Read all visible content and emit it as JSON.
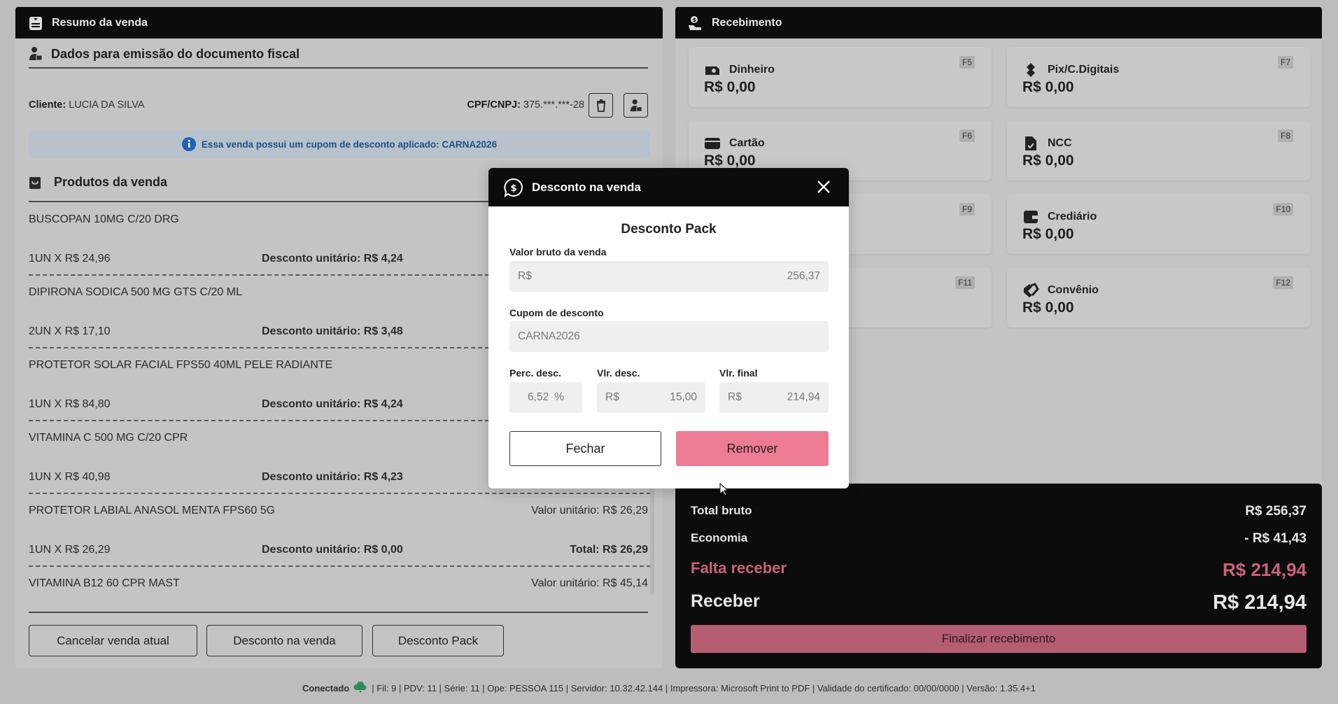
{
  "left_panel": {
    "title": "Resumo da venda",
    "fiscal_title": "Dados para emissão do documento fiscal",
    "client_label": "Cliente:",
    "client_name": "LUCIA DA SILVA",
    "cpf_label": "CPF/CNPJ:",
    "cpf_value": "375.***.***-28",
    "info_banner": "Essa venda possui um cupom de desconto aplicado: CARNA2026",
    "products_title": "Produtos da venda",
    "products": [
      {
        "name": "BUSCOPAN 10MG C/20 DRG",
        "qty": "1UN X R$ 24,96",
        "discount": "Desconto unitário: R$ 4,24"
      },
      {
        "name": "DIPIRONA SODICA 500 MG GTS C/20 ML",
        "qty": "2UN X R$ 17,10",
        "discount": "Desconto unitário: R$ 3,48"
      },
      {
        "name": "PROTETOR SOLAR FACIAL FPS50 40ML PELE RADIANTE",
        "qty": "1UN X R$ 84,80",
        "discount": "Desconto unitário: R$ 4,24"
      },
      {
        "name": "VITAMINA C 500 MG C/20 CPR",
        "qty": "1UN X R$ 40,98",
        "discount": "Desconto unitário: R$ 4,23"
      },
      {
        "name": "PROTETOR LABIAL ANASOL MENTA FPS60 5G",
        "unit": "Valor unitário: R$ 26,29",
        "qty": "1UN X R$ 26,29",
        "discount": "Desconto unitário: R$ 0,00",
        "total": "Total: R$ 26,29"
      },
      {
        "name": "VITAMINA B12 60 CPR MAST",
        "unit": "Valor unitário: R$ 45,14"
      }
    ],
    "buttons": {
      "cancel": "Cancelar venda atual",
      "sale_discount": "Desconto na venda",
      "pack_discount": "Desconto Pack"
    }
  },
  "right_panel": {
    "title": "Recebimento",
    "methods": [
      {
        "label": "Dinheiro",
        "amount": "R$  0,00",
        "key": "F5",
        "icon": "cash-icon"
      },
      {
        "label": "Pix/C.Digitais",
        "amount": "R$  0,00",
        "key": "F7",
        "icon": "pix-icon"
      },
      {
        "label": "Cartão",
        "amount": "R$  0,00",
        "key": "F6",
        "icon": "card-icon"
      },
      {
        "label": "NCC",
        "amount": "R$  0,00",
        "key": "F8",
        "icon": "document-check-icon"
      },
      {
        "label": "",
        "amount": "",
        "key": "F9",
        "icon": ""
      },
      {
        "label": "Crediário",
        "amount": "R$  0,00",
        "key": "F10",
        "icon": "wallet-icon"
      },
      {
        "label": "",
        "amount": "",
        "key": "F11",
        "icon": ""
      },
      {
        "label": "Convênio",
        "amount": "R$  0,00",
        "key": "F12",
        "icon": "handshake-icon"
      }
    ],
    "summary": {
      "total_bruto_label": "Total bruto",
      "total_bruto": "R$ 256,37",
      "economia_label": "Economia",
      "economia": "- R$ 41,43",
      "falta_label": "Falta receber",
      "falta": "R$ 214,94",
      "receber_label": "Receber",
      "receber": "R$ 214,94",
      "finalize": "Finalizar recebimento"
    }
  },
  "modal": {
    "title": "Desconto na venda",
    "subtitle": "Desconto Pack",
    "gross_label": "Valor bruto da venda",
    "gross_prefix": "R$",
    "gross_value": "256,37",
    "coupon_label": "Cupom de desconto",
    "coupon_value": "CARNA2026",
    "perc_label": "Perc. desc.",
    "perc_value": "6,52",
    "perc_suffix": "%",
    "vlr_label": "Vlr. desc.",
    "vlr_prefix": "R$",
    "vlr_value": "15,00",
    "final_label": "Vlr. final",
    "final_prefix": "R$",
    "final_value": "214,94",
    "close_button": "Fechar",
    "remove_button": "Remover"
  },
  "status_bar": {
    "connection": "Conectado",
    "details": "| Fil: 9 | PDV: 11 | Série: 11 | Ope: PESSOA 115 | Servidor: 10.32.42.144 | Impressora: Microsoft Print to PDF | Validade do certificado: 00/00/0000 | Versão: 1.35.4+1"
  },
  "colors": {
    "accent": "#b45d73",
    "remove": "#ec7b93",
    "falta": "#c8627c",
    "info": "#1f4f86",
    "header": "#0c0c0c",
    "connected": "#2e8b57"
  }
}
